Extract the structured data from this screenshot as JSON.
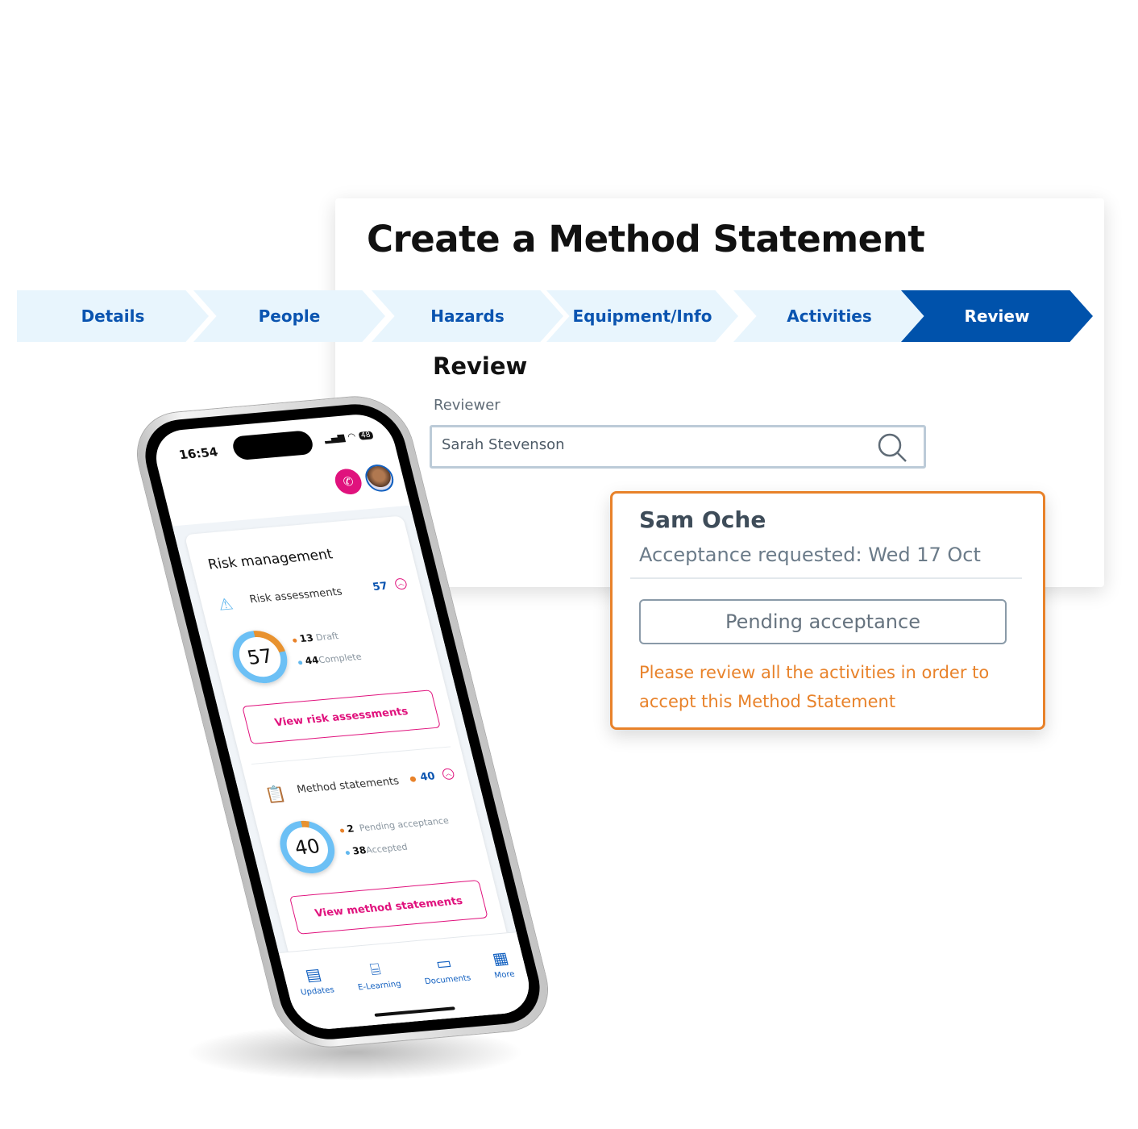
{
  "panel": {
    "title": "Create a Method Statement",
    "steps": [
      {
        "label": "Details",
        "active": false
      },
      {
        "label": "People",
        "active": false
      },
      {
        "label": "Hazards",
        "active": false
      },
      {
        "label": "Equipment/Info",
        "active": false
      },
      {
        "label": "Activities",
        "active": false
      },
      {
        "label": "Review",
        "active": true
      }
    ],
    "review_heading": "Review",
    "reviewer_label": "Reviewer",
    "reviewer_value": "Sarah Stevenson",
    "search_icon": "search-icon"
  },
  "popup": {
    "name": "Sam Oche",
    "requested": "Acceptance requested: Wed 17 Oct",
    "status_button": "Pending acceptance",
    "warning": "Please review all the activities in order to accept this Method Statement",
    "border_color": "#e8822a"
  },
  "phone": {
    "time": "16:54",
    "battery": "48",
    "section_title": "Risk management",
    "risk": {
      "label": "Risk assessments",
      "count": "57",
      "total": "57",
      "draft_count": "13",
      "draft_label": "Draft",
      "complete_count": "44",
      "complete_label": "Complete",
      "button": "View risk assessments"
    },
    "method": {
      "label": "Method statements",
      "count": "40",
      "total": "40",
      "pending_count": "2",
      "pending_label": "Pending acceptance",
      "accepted_count": "38",
      "accepted_label": "Accepted",
      "button": "View method statements"
    },
    "nav": [
      {
        "label": "Updates",
        "icon": "newspaper-icon"
      },
      {
        "label": "E-Learning",
        "icon": "presentation-icon"
      },
      {
        "label": "Documents",
        "icon": "folder-icon"
      },
      {
        "label": "More",
        "icon": "grid-icon"
      }
    ],
    "colors": {
      "accent": "#e0127d",
      "blue": "#0a54b0",
      "orange": "#e8822a",
      "light_blue": "#62b8ee"
    }
  }
}
